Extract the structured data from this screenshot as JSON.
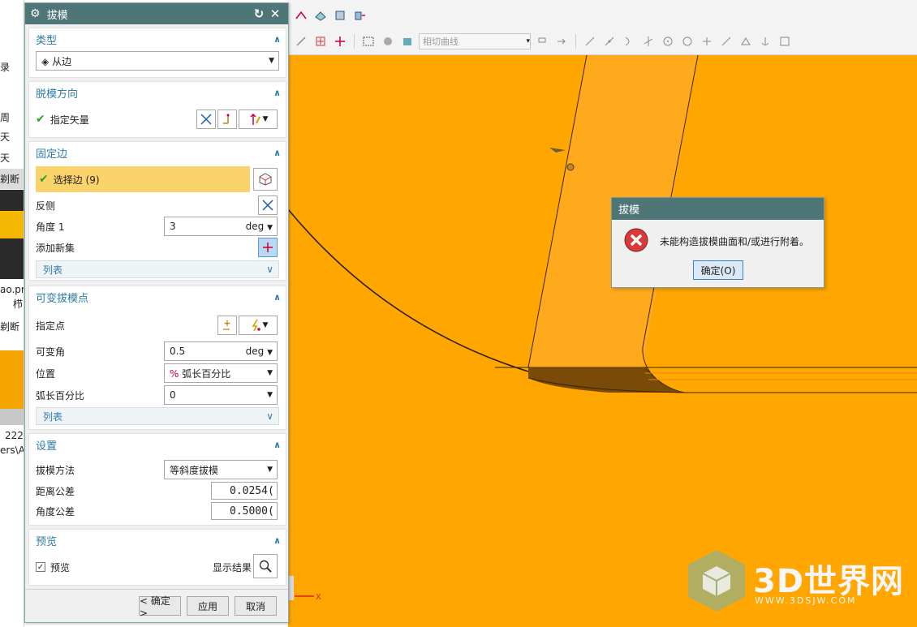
{
  "dialog": {
    "title": "拔模",
    "groups": {
      "type": {
        "header": "类型",
        "value": "从边"
      },
      "direction": {
        "header": "脱模方向",
        "specify_vector": "指定矢量"
      },
      "fixed_edge": {
        "header": "固定边",
        "select_edge": "选择边 (9)",
        "reverse": "反侧",
        "angle_label": "角度 1",
        "angle_value": "3",
        "angle_unit": "deg",
        "add_set": "添加新集",
        "list": "列表"
      },
      "variable_points": {
        "header": "可变拔模点",
        "specify_point": "指定点",
        "var_angle_label": "可变角",
        "var_angle_value": "0.5",
        "var_angle_unit": "deg",
        "position_label": "位置",
        "position_value": "弧长百分比",
        "arc_label": "弧长百分比",
        "arc_value": "0",
        "list": "列表"
      },
      "settings": {
        "header": "设置",
        "method_label": "拔模方法",
        "method_value": "等斜度拔模",
        "dist_tol_label": "距离公差",
        "dist_tol_value": "0.0254(",
        "angle_tol_label": "角度公差",
        "angle_tol_value": "0.5000("
      },
      "preview": {
        "header": "预览",
        "preview_label": "预览",
        "show_result": "显示结果"
      }
    },
    "buttons": {
      "ok": "< 确定 >",
      "apply": "应用",
      "cancel": "取消"
    }
  },
  "toolbar": {
    "curve_dropdown": "相切曲线"
  },
  "left_fragments": [
    "录",
    "周",
    "天",
    "天",
    "剃断",
    "ao.pr",
    "栉",
    "剃断",
    "222",
    "ers\\A"
  ],
  "error_dialog": {
    "title": "拔模",
    "message": "未能构造拔模曲面和/或进行附着。",
    "ok": "确定(O)"
  },
  "axis_label": "X",
  "watermark": {
    "text": "3D世界网",
    "url": "WWW.3DSJW.COM"
  },
  "colors": {
    "viewport": "#ffa600",
    "dialog_title": "#4f7677",
    "accent": "#2d7ca6",
    "highlight": "#fbd36b"
  }
}
